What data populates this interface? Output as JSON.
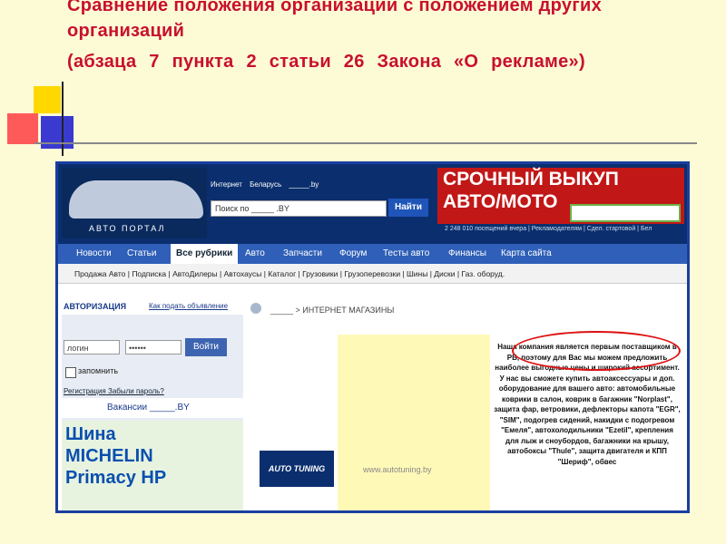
{
  "slide": {
    "title_line1": "Сравнение положения организации с положением других",
    "title_line2": "организаций",
    "title_line3": "(абзаца 7 пункта 2 статьи 26 Закона «О рекламе»)"
  },
  "site": {
    "logo_text": "АВТО ПОРТАЛ",
    "search": {
      "tabs": [
        "Интернет",
        "Беларусь",
        "_____.by"
      ],
      "placeholder": "Поиск по _____ .BY",
      "button": "Найти"
    },
    "ad": {
      "line1": "СРОЧНЫЙ ВЫКУП",
      "line2": "АВТО/МОТО"
    },
    "stats": "2 248 010 посещений вчера | Рекламодателям | Сдел. стартовой | Бел",
    "nav": [
      "Новости",
      "Статьи",
      "Все рубрики",
      "Авто",
      "Запчасти",
      "Форум",
      "Тесты авто",
      "Финансы",
      "Карта сайта"
    ],
    "subnav": [
      "Продажа Авто",
      "Подписка",
      "АвтоДилеры",
      "Автохаусы",
      "Каталог",
      "Грузовики",
      "Грузоперевозки",
      "Шины",
      "Диски",
      "Газ. оборуд."
    ],
    "auth": {
      "title": "АВТОРИЗАЦИЯ",
      "add_link": "Как подать объявление",
      "login_placeholder": "логин",
      "password_mask": "••••••",
      "login_button": "Войти",
      "remember": "запомнить",
      "register": "Регистрация",
      "forgot": "Забыли пароль?"
    },
    "vacancies": "Вакансии _____.BY",
    "banner": [
      "Шина",
      "MICHELIN",
      "Primacy HP"
    ],
    "breadcrumb": "_____ > ИНТЕРНЕТ МАГАЗИНЫ",
    "shop_logo": "AUTO TUNING",
    "shop_url": "www.autotuning.by",
    "description": "Наша компания является первым поставщиком в РБ, поэтому для Вас мы можем предложить наиболее выгодные цены и широкий ассортимент. У нас вы сможете купить автоаксессуары и доп. оборудование для вашего авто: автомобильные коврики в салон, коврик в багажник \"Norplast\", защита фар, ветровики, дефлекторы капота \"EGR\", \"SIM\", подогрев сидений, накидки с подогревом \"Емеля\", автохолодильники \"Ezetil\", крепления для лыж и сноубордов, багажники на крышу, автобоксы \"Thule\", защита двигателя и КПП \"Шериф\", обвес"
  },
  "colors": {
    "title_red": "#c8102e",
    "header_blue": "#0b2f6e",
    "nav_blue": "#2f5fb8",
    "ad_red": "#c21717"
  }
}
